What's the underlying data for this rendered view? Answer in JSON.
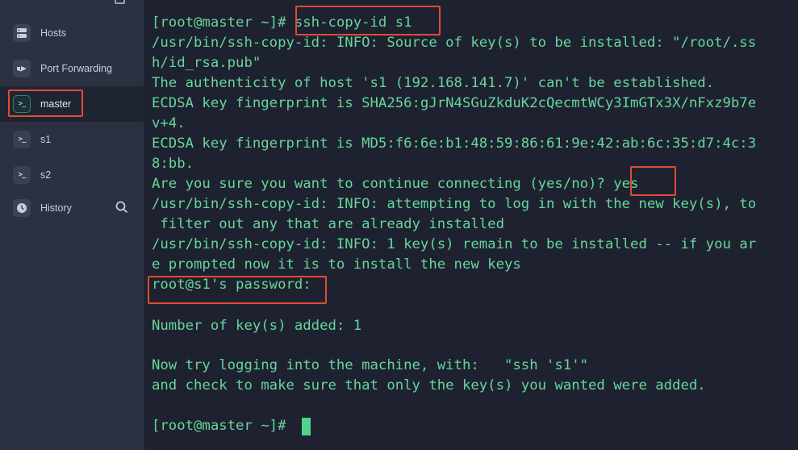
{
  "sidebar": {
    "items": [
      {
        "label": "Hosts",
        "icon": "hosts-icon"
      },
      {
        "label": "Port Forwarding",
        "icon": "port-forwarding-icon"
      },
      {
        "label": "master",
        "icon": "terminal-icon",
        "active": true
      },
      {
        "label": "s1",
        "icon": "terminal-icon"
      },
      {
        "label": "s2",
        "icon": "terminal-icon"
      },
      {
        "label": "History",
        "icon": "history-icon"
      }
    ],
    "terminal_glyph": ">_"
  },
  "terminal": {
    "lines": [
      "[root@master ~]# ssh-copy-id s1",
      "/usr/bin/ssh-copy-id: INFO: Source of key(s) to be installed: \"/root/.ss",
      "h/id_rsa.pub\"",
      "The authenticity of host 's1 (192.168.141.7)' can't be established.",
      "ECDSA key fingerprint is SHA256:gJrN4SGuZkduK2cQecmtWCy3ImGTx3X/nFxz9b7e",
      "v+4.",
      "ECDSA key fingerprint is MD5:f6:6e:b1:48:59:86:61:9e:42:ab:6c:35:d7:4c:3",
      "8:bb.",
      "Are you sure you want to continue connecting (yes/no)? yes",
      "/usr/bin/ssh-copy-id: INFO: attempting to log in with the new key(s), to",
      " filter out any that are already installed",
      "/usr/bin/ssh-copy-id: INFO: 1 key(s) remain to be installed -- if you ar",
      "e prompted now it is to install the new keys",
      "root@s1's password:",
      "Number of key(s) added: 1",
      "Now try logging into the machine, with:   \"ssh 's1'\"",
      "and check to make sure that only the key(s) you wanted were added.",
      "[root@master ~]# "
    ]
  },
  "colors": {
    "terminal_text": "#66d69a",
    "terminal_bg": "#1e2230",
    "sidebar_bg": "#2b3140",
    "highlight": "#e04a39",
    "cursor": "#4fd58b"
  }
}
